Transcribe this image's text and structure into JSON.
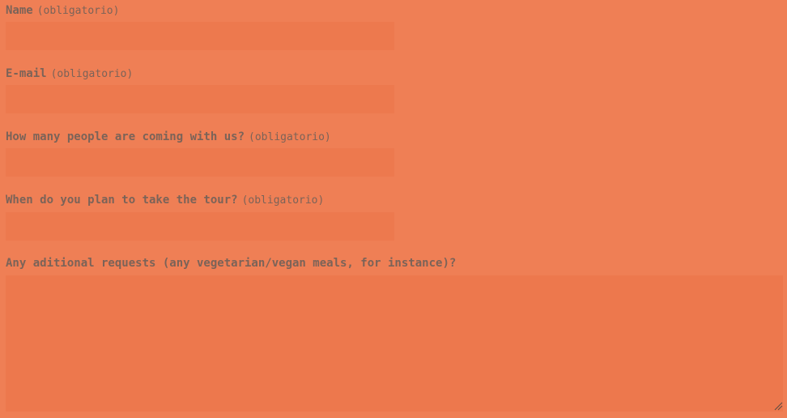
{
  "form": {
    "required_hint": "(obligatorio)",
    "name": {
      "label": "Name",
      "value": ""
    },
    "email": {
      "label": "E-mail",
      "value": ""
    },
    "people": {
      "label": "How many people are coming with us?",
      "value": ""
    },
    "tour_date": {
      "label": "When do you plan to take the tour?",
      "value": ""
    },
    "requests": {
      "label": "Any aditional requests (any vegetarian/vegan meals, for instance)?",
      "value": ""
    }
  },
  "colors": {
    "background": "#ef7f55",
    "field": "#ed794e",
    "text": "#7b6358"
  },
  "icons": {
    "textarea_resize": "resize-grip-icon"
  }
}
